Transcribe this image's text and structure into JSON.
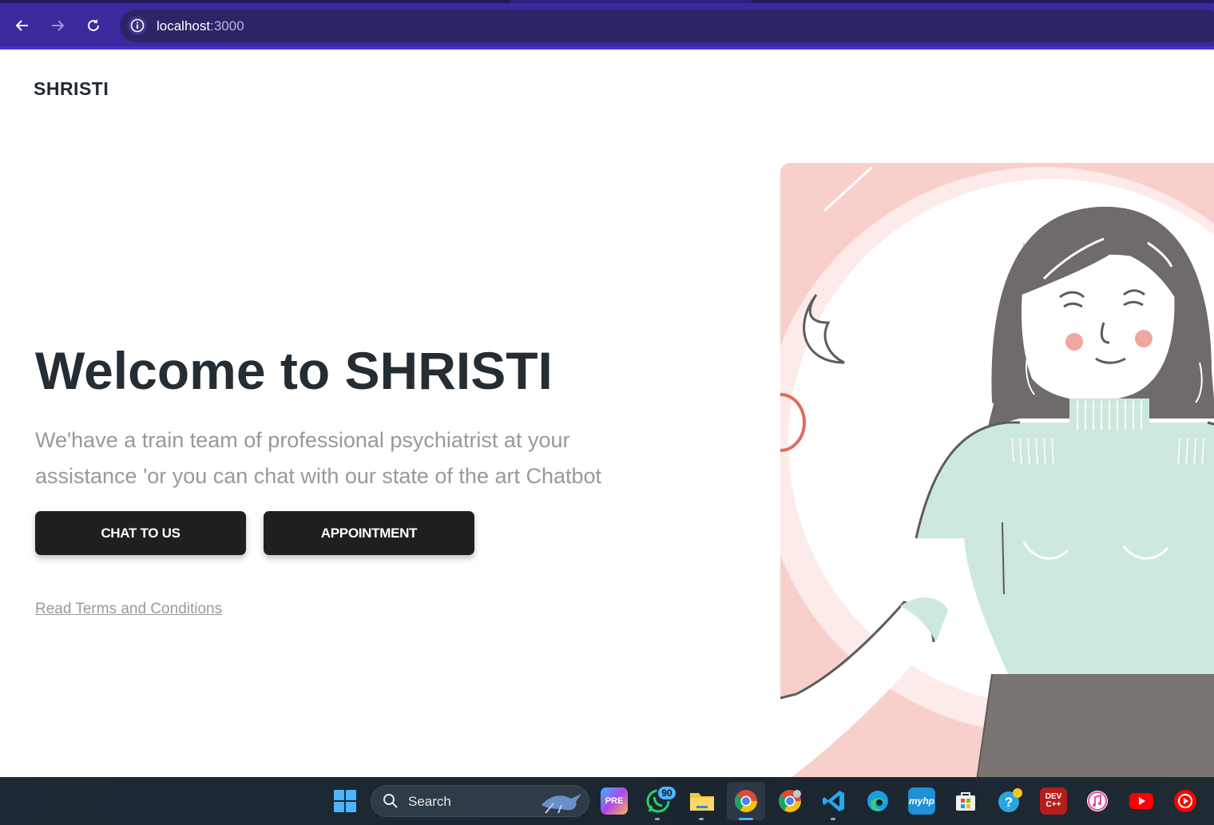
{
  "browser": {
    "url_host": "localhost",
    "url_port": ":3000"
  },
  "site": {
    "brand": "SHRISTI",
    "hero_title": "Welcome to SHRISTI",
    "hero_subtitle": "We'have a train team of professional psychiatrist at your assistance 'or you can chat with our state of the art Chatbot",
    "chat_button": "CHAT TO US",
    "appointment_button": "APPOINTMENT",
    "terms_link": "Read Terms and Conditions"
  },
  "taskbar": {
    "search_placeholder": "Search",
    "whatsapp_badge": "90",
    "icons": [
      "windows-start-icon",
      "copilot-icon",
      "whatsapp-icon",
      "file-explorer-icon",
      "chrome-icon",
      "chrome-profile-icon",
      "vscode-icon",
      "edge-icon",
      "myhp-icon",
      "microsoft-store-icon",
      "get-help-icon",
      "devcpp-icon",
      "itunes-icon",
      "youtube-icon",
      "youtube-music-icon"
    ],
    "devcpp_label": "DEV C++",
    "myhp_label": "myhp"
  },
  "colors": {
    "chrome_bg": "#3a2a9e",
    "button_bg": "#1f1f1f",
    "title_color": "#242d34",
    "illustration_bg": "#f9cfcc",
    "sweater": "#cde8dc"
  }
}
